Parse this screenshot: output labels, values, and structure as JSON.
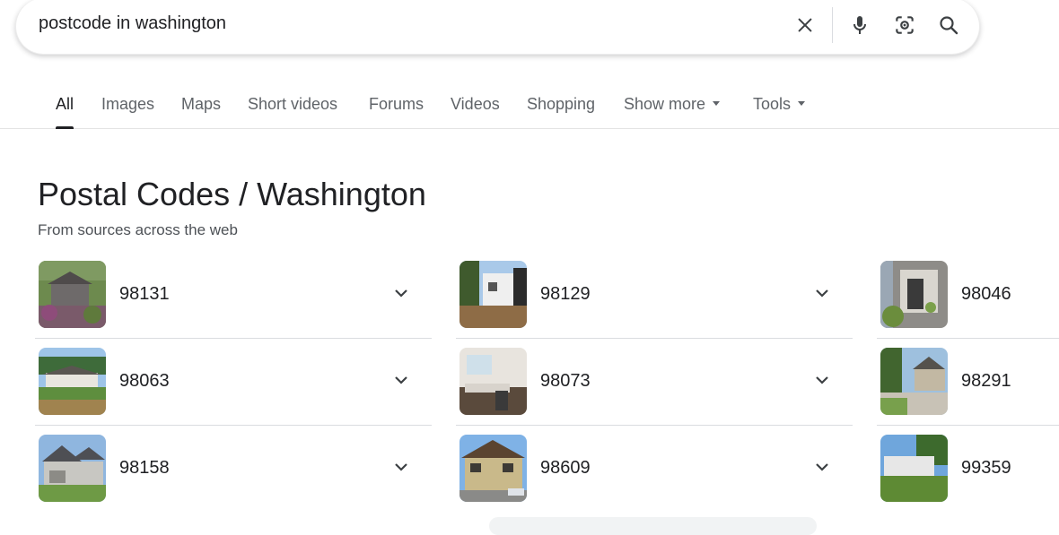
{
  "search": {
    "query": "postcode in washington",
    "icons": [
      "close-icon",
      "mic-icon",
      "lens-icon",
      "search-icon"
    ]
  },
  "tabs": [
    {
      "label": "All",
      "active": true
    },
    {
      "label": "Images"
    },
    {
      "label": "Maps"
    },
    {
      "label": "Short videos"
    },
    {
      "label": "Forums"
    },
    {
      "label": "Videos"
    },
    {
      "label": "Shopping"
    },
    {
      "label": "Show more",
      "dropdown": true
    },
    {
      "label": "Tools",
      "dropdown": true
    }
  ],
  "result": {
    "title": "Postal Codes / Washington",
    "subtitle": "From sources across the web",
    "items": [
      {
        "code": "98131"
      },
      {
        "code": "98129"
      },
      {
        "code": "98046"
      },
      {
        "code": "98063"
      },
      {
        "code": "98073"
      },
      {
        "code": "98291"
      },
      {
        "code": "98158"
      },
      {
        "code": "98609"
      },
      {
        "code": "99359"
      }
    ]
  },
  "colors": {
    "text": "#202124",
    "muted": "#5f6368",
    "divider": "#dadce0"
  }
}
